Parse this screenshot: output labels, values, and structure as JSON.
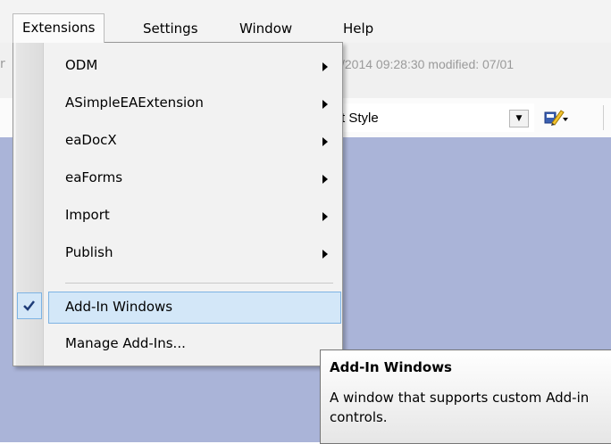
{
  "menubar": {
    "items": [
      "Extensions",
      "Settings",
      "Window",
      "Help"
    ]
  },
  "background": {
    "left_fragment": "r",
    "info_text": "/2014 09:28:30  modified: 07/01",
    "style_text": "t Style"
  },
  "menu": {
    "items": [
      {
        "label": "ODM",
        "submenu": true
      },
      {
        "label": "ASimpleEAExtension",
        "submenu": true
      },
      {
        "label": "eaDocX",
        "submenu": true
      },
      {
        "label": "eaForms",
        "submenu": true
      },
      {
        "label": "Import",
        "submenu": true
      },
      {
        "label": "Publish",
        "submenu": true
      },
      {
        "label": "Add-In Windows",
        "submenu": false,
        "checked": true,
        "highlighted": true
      },
      {
        "label": "Manage Add-Ins...",
        "submenu": false
      }
    ]
  },
  "tooltip": {
    "title": "Add-In Windows",
    "body": "A window that supports custom Add-in controls."
  },
  "colors": {
    "canvas": "#aab4d8",
    "highlight": "#d3e7f8",
    "highlight_border": "#7db3e3",
    "check": "#1e3c78"
  }
}
